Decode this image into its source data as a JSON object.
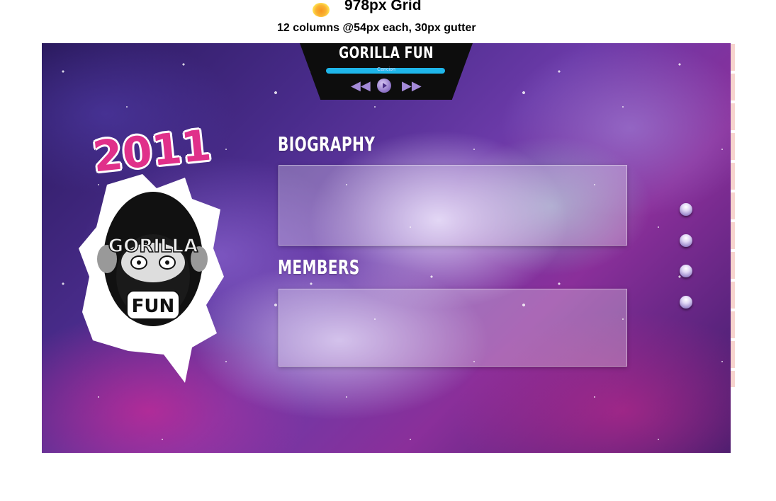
{
  "grid_header": {
    "title": "978px Grid",
    "subtitle": "12 columns @54px each, 30px gutter"
  },
  "player": {
    "band_name": "GORILLA FUN",
    "song_label": "Cancion",
    "prev_icon": "rewind-icon",
    "play_icon": "play-icon",
    "next_icon": "fast-forward-icon"
  },
  "logo": {
    "year": "2011",
    "text_line1": "GORILLA",
    "text_line2": "FUN"
  },
  "sections": {
    "biography": {
      "heading": "BIOGRAPHY"
    },
    "members": {
      "heading": "MEMBERS"
    }
  },
  "colors": {
    "accent_pink": "#e0308a",
    "player_bar": "#1fb6ea",
    "player_bg": "#0d0d0d"
  },
  "nav_dots": [
    "nav-dot-1",
    "nav-dot-2",
    "nav-dot-3",
    "nav-dot-4"
  ]
}
